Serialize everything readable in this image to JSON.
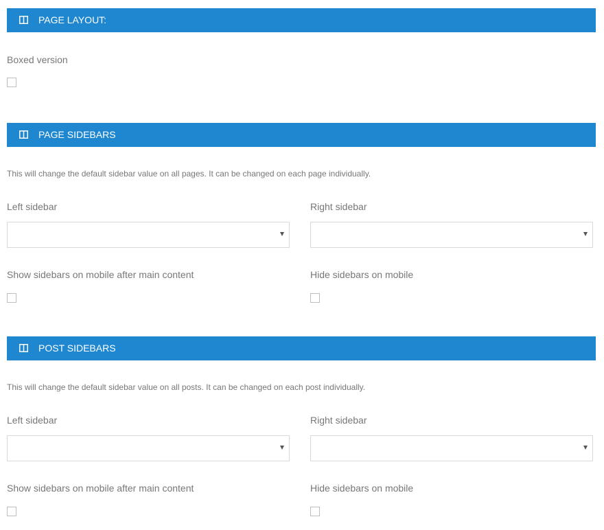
{
  "page_layout": {
    "header_title": "PAGE LAYOUT:",
    "header_icon": "columns-icon",
    "boxed_label": "Boxed version",
    "boxed_checked": false
  },
  "page_sidebars": {
    "header_title": "PAGE SIDEBARS",
    "header_icon": "columns-icon",
    "description": "This will change the default sidebar value on all pages. It can be changed on each page individually.",
    "left_label": "Left sidebar",
    "left_value": "",
    "right_label": "Right sidebar",
    "right_value": "",
    "show_mobile_label": "Show sidebars on mobile after main content",
    "show_mobile_checked": false,
    "hide_mobile_label": "Hide sidebars on mobile",
    "hide_mobile_checked": false
  },
  "post_sidebars": {
    "header_title": "POST SIDEBARS",
    "header_icon": "columns-icon",
    "description": "This will change the default sidebar value on all posts. It can be changed on each post individually.",
    "left_label": "Left sidebar",
    "left_value": "",
    "right_label": "Right sidebar",
    "right_value": "",
    "show_mobile_label": "Show sidebars on mobile after main content",
    "show_mobile_checked": false,
    "hide_mobile_label": "Hide sidebars on mobile",
    "hide_mobile_checked": false
  },
  "colors": {
    "header_bg": "#1e87d0",
    "header_text": "#ffffff",
    "label_text": "#777777"
  }
}
